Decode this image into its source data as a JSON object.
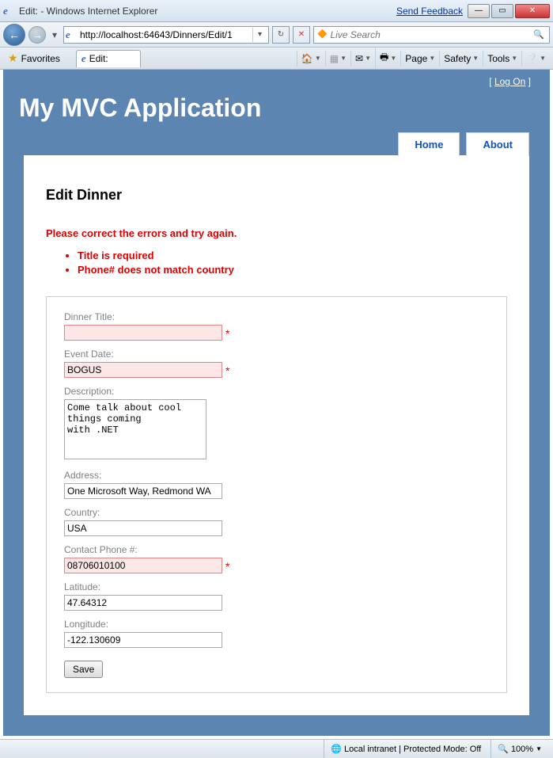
{
  "window": {
    "title": "Edit: - Windows Internet Explorer",
    "send_feedback": "Send Feedback"
  },
  "nav": {
    "url": "http://localhost:64643/Dinners/Edit/1",
    "search_placeholder": "Live Search"
  },
  "tabs": {
    "favorites": "Favorites",
    "current": "Edit:"
  },
  "commands": {
    "page": "Page",
    "safety": "Safety",
    "tools": "Tools"
  },
  "auth": {
    "logon": "Log On"
  },
  "app": {
    "title": "My MVC Application",
    "nav_home": "Home",
    "nav_about": "About"
  },
  "content": {
    "heading": "Edit Dinner",
    "error_summary": "Please correct the errors and try again.",
    "errors": {
      "e0": "Title is required",
      "e1": "Phone# does not match country"
    },
    "labels": {
      "title": "Dinner Title:",
      "event_date": "Event Date:",
      "description": "Description:",
      "address": "Address:",
      "country": "Country:",
      "phone": "Contact Phone #:",
      "latitude": "Latitude:",
      "longitude": "Longitude:"
    },
    "values": {
      "title": "",
      "event_date": "BOGUS",
      "description": "Come talk about cool things coming\nwith .NET",
      "address": "One Microsoft Way, Redmond WA",
      "country": "USA",
      "phone": "08706010100",
      "latitude": "47.64312",
      "longitude": "-122.130609"
    },
    "asterisk": "*",
    "save": "Save"
  },
  "status": {
    "zone": "Local intranet | Protected Mode: Off",
    "zoom": "100%"
  }
}
